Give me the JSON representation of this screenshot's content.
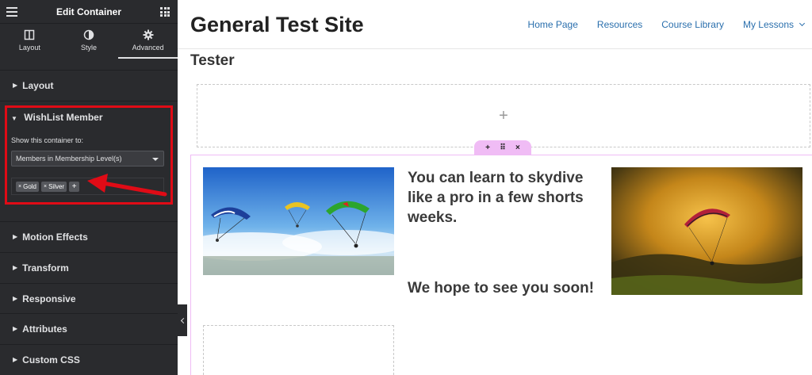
{
  "editor": {
    "title": "Edit Container",
    "tabs": [
      {
        "label": "Layout",
        "icon": "layout-icon"
      },
      {
        "label": "Style",
        "icon": "style-icon"
      },
      {
        "label": "Advanced",
        "icon": "gear-icon",
        "active": true
      }
    ],
    "sections": {
      "layout": "Layout",
      "motion": "Motion Effects",
      "transform": "Transform",
      "responsive": "Responsive",
      "attributes": "Attributes",
      "css": "Custom CSS"
    },
    "wishlist": {
      "title": "WishList Member",
      "show_label": "Show this container to:",
      "select_value": "Members in Membership Level(s)",
      "tags": [
        "Gold",
        "Silver"
      ],
      "tag_remove_glyph": "×",
      "add_glyph": "+"
    }
  },
  "site": {
    "title": "General Test Site",
    "nav": [
      "Home Page",
      "Resources",
      "Course Library",
      "My Lessons"
    ],
    "page_heading": "Tester",
    "empty_plus": "+",
    "container_tools": {
      "add": "+",
      "move": "⠿",
      "close": "×"
    },
    "headline": "You can learn to skydive like a pro in a few shorts weeks.",
    "subline": "We hope to see you soon!"
  },
  "colors": {
    "panel_bg": "#2a2b2e",
    "highlight_red": "#e00b16",
    "link_blue": "#2a6fad",
    "container_pink": "#f0bcf5"
  }
}
